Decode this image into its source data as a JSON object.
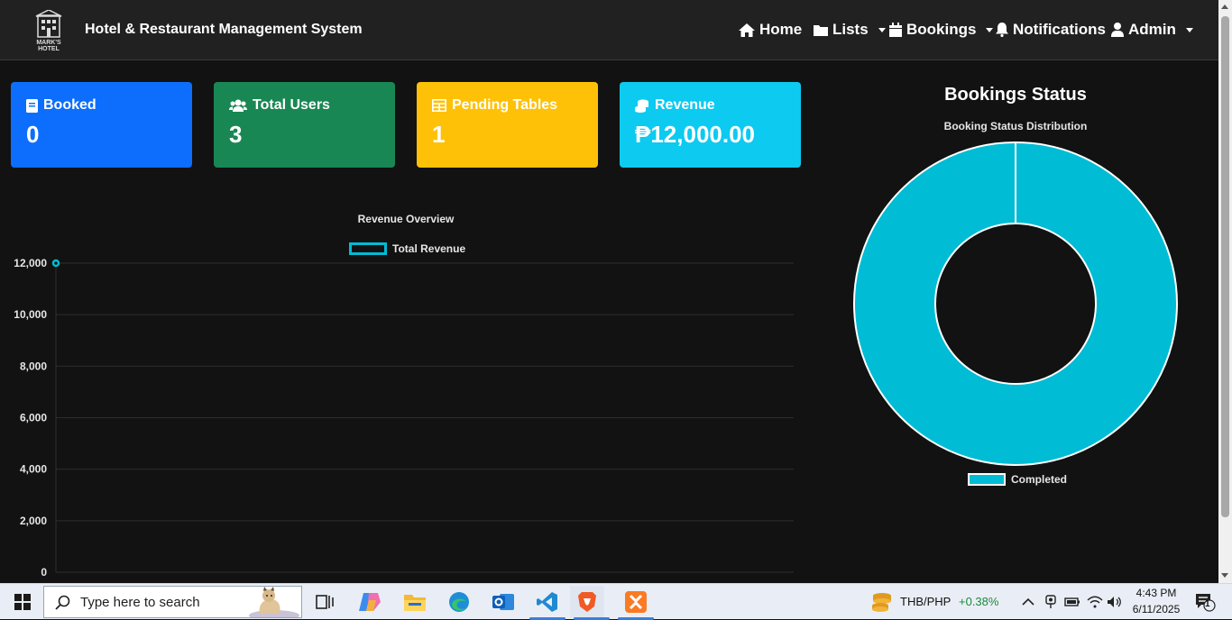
{
  "navbar": {
    "logo_text": "MARK'S HOTEL",
    "brand": "Hotel & Restaurant Management System",
    "items": [
      {
        "label": "Home",
        "icon": "home-icon",
        "dropdown": false
      },
      {
        "label": "Lists",
        "icon": "folder-icon",
        "dropdown": true
      },
      {
        "label": "Bookings",
        "icon": "calendar-icon",
        "dropdown": true
      },
      {
        "label": "Notifications",
        "icon": "bell-icon",
        "dropdown": false
      },
      {
        "label": "Admin",
        "icon": "user-icon",
        "dropdown": true
      }
    ]
  },
  "cards": [
    {
      "title": "Booked",
      "value": "0",
      "color": "#0d6efd",
      "icon": "book-icon"
    },
    {
      "title": "Total Users",
      "value": "3",
      "color": "#198754",
      "icon": "users-icon"
    },
    {
      "title": "Pending Tables",
      "value": "1",
      "color": "#ffc107",
      "icon": "table-icon"
    },
    {
      "title": "Revenue",
      "value": "₱12,000.00",
      "color": "#0dcaf0",
      "icon": "coins-icon"
    }
  ],
  "revenue_chart": {
    "section_title": "",
    "chart_data": {
      "type": "line",
      "title": "Revenue Overview",
      "series": [
        {
          "name": "Total Revenue",
          "values": [
            12000
          ]
        }
      ],
      "ylim": [
        0,
        12000
      ],
      "yticks": [
        "0",
        "2,000",
        "4,000",
        "6,000",
        "8,000",
        "10,000",
        "12,000"
      ],
      "grid": true,
      "legend": "top",
      "color": "#00bcd4"
    }
  },
  "status_chart": {
    "section_title": "Bookings Status",
    "chart_data": {
      "type": "pie",
      "title": "Booking Status Distribution",
      "categories": [
        "Completed"
      ],
      "values": [
        1
      ],
      "legend": "bottom",
      "color": "#00bcd4"
    }
  },
  "taskbar": {
    "search_placeholder": "Type here to search",
    "ticker_pair": "THB/PHP",
    "ticker_change": "+0.38%",
    "time": "4:43 PM",
    "date": "6/11/2025",
    "notification_count": "1",
    "apps": [
      "task-view-icon",
      "copilot-icon",
      "file-explorer-icon",
      "edge-icon",
      "outlook-icon",
      "vscode-icon",
      "brave-icon",
      "xampp-icon"
    ]
  }
}
